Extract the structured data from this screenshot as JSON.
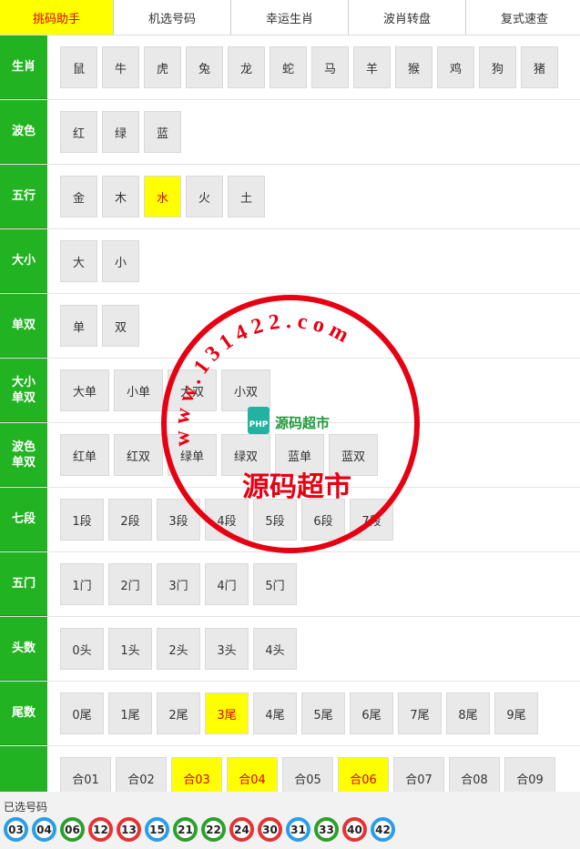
{
  "tabs": [
    {
      "label": "挑码助手",
      "active": true
    },
    {
      "label": "机选号码",
      "active": false
    },
    {
      "label": "幸运生肖",
      "active": false
    },
    {
      "label": "波肖转盘",
      "active": false
    },
    {
      "label": "复式速查",
      "active": false
    }
  ],
  "rows": [
    {
      "label": "生肖",
      "options": [
        {
          "t": "鼠"
        },
        {
          "t": "牛"
        },
        {
          "t": "虎"
        },
        {
          "t": "兔"
        },
        {
          "t": "龙"
        },
        {
          "t": "蛇"
        },
        {
          "t": "马"
        },
        {
          "t": "羊"
        },
        {
          "t": "猴"
        },
        {
          "t": "鸡"
        },
        {
          "t": "狗"
        },
        {
          "t": "猪"
        }
      ]
    },
    {
      "label": "波色",
      "options": [
        {
          "t": "红"
        },
        {
          "t": "绿"
        },
        {
          "t": "蓝"
        }
      ]
    },
    {
      "label": "五行",
      "options": [
        {
          "t": "金"
        },
        {
          "t": "木"
        },
        {
          "t": "水",
          "sel": true
        },
        {
          "t": "火"
        },
        {
          "t": "土"
        }
      ]
    },
    {
      "label": "大小",
      "options": [
        {
          "t": "大"
        },
        {
          "t": "小"
        }
      ]
    },
    {
      "label": "单双",
      "options": [
        {
          "t": "单"
        },
        {
          "t": "双"
        }
      ]
    },
    {
      "label": "大小\n单双",
      "options": [
        {
          "t": "大单"
        },
        {
          "t": "小单"
        },
        {
          "t": "大双"
        },
        {
          "t": "小双"
        }
      ]
    },
    {
      "label": "波色\n单双",
      "options": [
        {
          "t": "红单"
        },
        {
          "t": "红双"
        },
        {
          "t": "绿单"
        },
        {
          "t": "绿双"
        },
        {
          "t": "蓝单"
        },
        {
          "t": "蓝双"
        }
      ]
    },
    {
      "label": "七段",
      "options": [
        {
          "t": "1段"
        },
        {
          "t": "2段"
        },
        {
          "t": "3段"
        },
        {
          "t": "4段"
        },
        {
          "t": "5段"
        },
        {
          "t": "6段"
        },
        {
          "t": "7段"
        }
      ]
    },
    {
      "label": "五门",
      "options": [
        {
          "t": "1门"
        },
        {
          "t": "2门"
        },
        {
          "t": "3门"
        },
        {
          "t": "4门"
        },
        {
          "t": "5门"
        }
      ]
    },
    {
      "label": "头数",
      "options": [
        {
          "t": "0头"
        },
        {
          "t": "1头"
        },
        {
          "t": "2头"
        },
        {
          "t": "3头"
        },
        {
          "t": "4头"
        }
      ]
    },
    {
      "label": "尾数",
      "options": [
        {
          "t": "0尾"
        },
        {
          "t": "1尾"
        },
        {
          "t": "2尾"
        },
        {
          "t": "3尾",
          "sel": true
        },
        {
          "t": "4尾"
        },
        {
          "t": "5尾"
        },
        {
          "t": "6尾"
        },
        {
          "t": "7尾"
        },
        {
          "t": "8尾"
        },
        {
          "t": "9尾"
        }
      ]
    },
    {
      "label": "",
      "options": [
        {
          "t": "合01"
        },
        {
          "t": "合02"
        },
        {
          "t": "合03",
          "sel": true
        },
        {
          "t": "合04",
          "sel": true
        },
        {
          "t": "合05"
        },
        {
          "t": "合06",
          "sel": true
        },
        {
          "t": "合07"
        },
        {
          "t": "合08"
        },
        {
          "t": "合09"
        }
      ]
    }
  ],
  "selected": {
    "title": "已选号码",
    "balls": [
      {
        "n": "03",
        "c": "blue"
      },
      {
        "n": "04",
        "c": "blue"
      },
      {
        "n": "06",
        "c": "green"
      },
      {
        "n": "12",
        "c": "red"
      },
      {
        "n": "13",
        "c": "red"
      },
      {
        "n": "15",
        "c": "blue"
      },
      {
        "n": "21",
        "c": "green"
      },
      {
        "n": "22",
        "c": "green"
      },
      {
        "n": "24",
        "c": "red"
      },
      {
        "n": "30",
        "c": "red"
      },
      {
        "n": "31",
        "c": "blue"
      },
      {
        "n": "33",
        "c": "green"
      },
      {
        "n": "40",
        "c": "red"
      },
      {
        "n": "42",
        "c": "blue"
      }
    ]
  },
  "watermark": {
    "ring_text": "www.131422.com",
    "center_text": "源码超市",
    "logo_badge": "PHP",
    "logo_text": "源码超市",
    "color": "#e60012"
  },
  "colors": {
    "accent_green": "#22b322",
    "selected_yellow": "#ffff00",
    "selected_text": "#dd0000"
  }
}
